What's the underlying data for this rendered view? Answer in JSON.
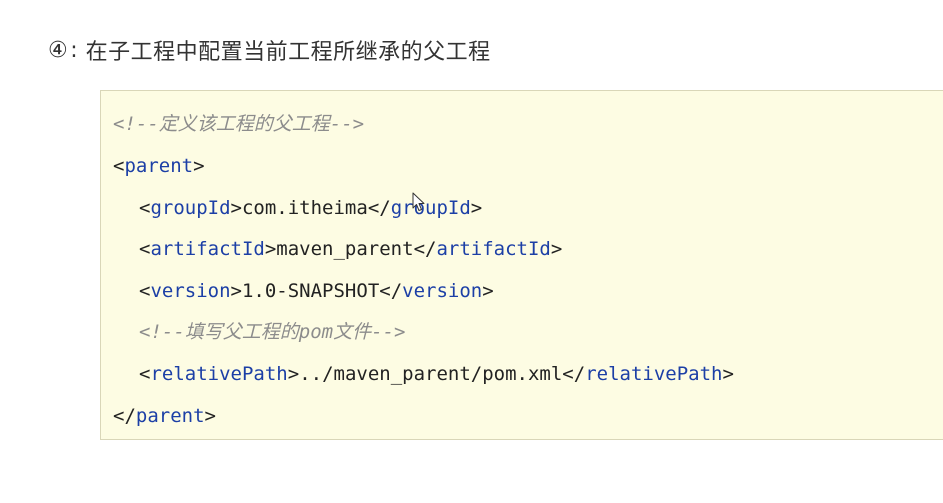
{
  "heading": {
    "number": "④",
    "separator": ":",
    "text": "在子工程中配置当前工程所继承的父工程"
  },
  "code": {
    "comment_define": "<!--定义该工程的父工程-->",
    "parent_open": {
      "lt": "<",
      "name": "parent",
      "gt": ">"
    },
    "group_id": {
      "open_lt": "<",
      "name": "groupId",
      "open_gt": ">",
      "value": "com.itheima",
      "close_lt": "</",
      "close_gt": ">"
    },
    "artifact_id": {
      "open_lt": "<",
      "name": "artifactId",
      "open_gt": ">",
      "value": "maven_parent",
      "close_lt": "</",
      "close_gt": ">"
    },
    "version": {
      "open_lt": "<",
      "name": "version",
      "open_gt": ">",
      "value": "1.0-SNAPSHOT",
      "close_lt": "</",
      "close_gt": ">"
    },
    "comment_pom": "<!--填写父工程的pom文件-->",
    "relative_path": {
      "open_lt": "<",
      "name": "relativePath",
      "open_gt": ">",
      "value": "../maven_parent/pom.xml",
      "close_lt": "</",
      "close_gt": ">"
    },
    "parent_close": {
      "lt": "</",
      "name": "parent",
      "gt": ">"
    }
  },
  "colors": {
    "background": "#fdfce3",
    "tag": "#1c3fa6",
    "comment": "#8c8c8c"
  },
  "icons": {
    "cursor": "mouse-pointer-icon"
  }
}
